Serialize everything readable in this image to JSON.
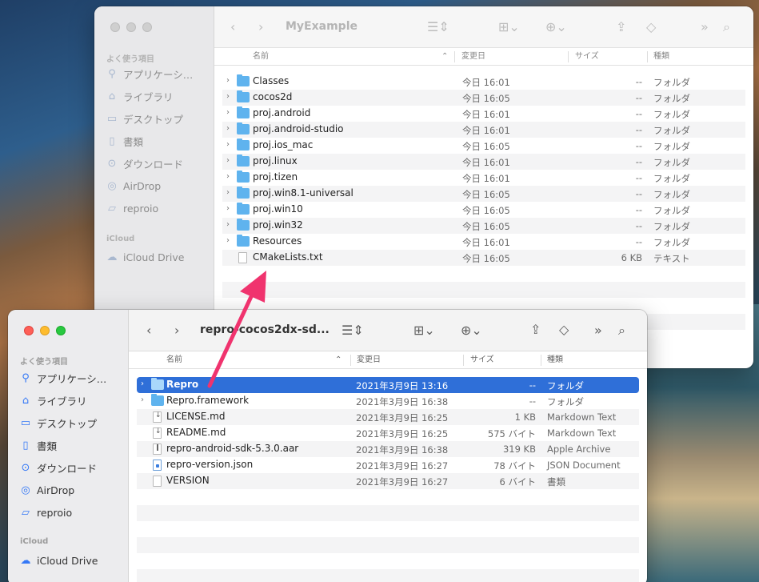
{
  "window_back": {
    "title": "MyExample",
    "sidebar": {
      "favorites_label": "よく使う項目",
      "items": [
        {
          "label": "アプリケーシ…",
          "icon": "applications-icon"
        },
        {
          "label": "ライブラリ",
          "icon": "library-icon"
        },
        {
          "label": "デスクトップ",
          "icon": "desktop-icon"
        },
        {
          "label": "書類",
          "icon": "documents-icon"
        },
        {
          "label": "ダウンロード",
          "icon": "downloads-icon"
        },
        {
          "label": "AirDrop",
          "icon": "airdrop-icon"
        },
        {
          "label": "reproio",
          "icon": "folder-icon"
        }
      ],
      "icloud_label": "iCloud",
      "icloud_items": [
        {
          "label": "iCloud Drive",
          "icon": "cloud-icon"
        }
      ]
    },
    "columns": {
      "name": "名前",
      "modified": "変更日",
      "size": "サイズ",
      "kind": "種類"
    },
    "rows": [
      {
        "name": "Classes",
        "date": "今日 16:01",
        "size": "--",
        "kind": "フォルダ",
        "type": "folder"
      },
      {
        "name": "cocos2d",
        "date": "今日 16:05",
        "size": "--",
        "kind": "フォルダ",
        "type": "folder"
      },
      {
        "name": "proj.android",
        "date": "今日 16:01",
        "size": "--",
        "kind": "フォルダ",
        "type": "folder"
      },
      {
        "name": "proj.android-studio",
        "date": "今日 16:01",
        "size": "--",
        "kind": "フォルダ",
        "type": "folder"
      },
      {
        "name": "proj.ios_mac",
        "date": "今日 16:05",
        "size": "--",
        "kind": "フォルダ",
        "type": "folder"
      },
      {
        "name": "proj.linux",
        "date": "今日 16:01",
        "size": "--",
        "kind": "フォルダ",
        "type": "folder"
      },
      {
        "name": "proj.tizen",
        "date": "今日 16:01",
        "size": "--",
        "kind": "フォルダ",
        "type": "folder"
      },
      {
        "name": "proj.win8.1-universal",
        "date": "今日 16:05",
        "size": "--",
        "kind": "フォルダ",
        "type": "folder"
      },
      {
        "name": "proj.win10",
        "date": "今日 16:05",
        "size": "--",
        "kind": "フォルダ",
        "type": "folder"
      },
      {
        "name": "proj.win32",
        "date": "今日 16:05",
        "size": "--",
        "kind": "フォルダ",
        "type": "folder"
      },
      {
        "name": "Resources",
        "date": "今日 16:01",
        "size": "--",
        "kind": "フォルダ",
        "type": "folder"
      },
      {
        "name": "CMakeLists.txt",
        "date": "今日 16:05",
        "size": "6 KB",
        "kind": "テキスト",
        "type": "doc"
      }
    ]
  },
  "window_front": {
    "title": "repro-cocos2dx-sd...",
    "sidebar": {
      "favorites_label": "よく使う項目",
      "items": [
        {
          "label": "アプリケーシ…",
          "icon": "applications-icon"
        },
        {
          "label": "ライブラリ",
          "icon": "library-icon"
        },
        {
          "label": "デスクトップ",
          "icon": "desktop-icon"
        },
        {
          "label": "書類",
          "icon": "documents-icon"
        },
        {
          "label": "ダウンロード",
          "icon": "downloads-icon"
        },
        {
          "label": "AirDrop",
          "icon": "airdrop-icon"
        },
        {
          "label": "reproio",
          "icon": "folder-icon"
        }
      ],
      "icloud_label": "iCloud",
      "icloud_items": [
        {
          "label": "iCloud Drive",
          "icon": "cloud-icon"
        }
      ]
    },
    "columns": {
      "name": "名前",
      "modified": "変更日",
      "size": "サイズ",
      "kind": "種類"
    },
    "rows": [
      {
        "name": "Repro",
        "date": "2021年3月9日 13:16",
        "size": "--",
        "kind": "フォルダ",
        "type": "folder",
        "selected": true
      },
      {
        "name": "Repro.framework",
        "date": "2021年3月9日 16:38",
        "size": "--",
        "kind": "フォルダ",
        "type": "folder"
      },
      {
        "name": "LICENSE.md",
        "date": "2021年3月9日 16:25",
        "size": "1 KB",
        "kind": "Markdown Text",
        "type": "md"
      },
      {
        "name": "README.md",
        "date": "2021年3月9日 16:25",
        "size": "575 バイト",
        "kind": "Markdown Text",
        "type": "md"
      },
      {
        "name": "repro-android-sdk-5.3.0.aar",
        "date": "2021年3月9日 16:38",
        "size": "319 KB",
        "kind": "Apple Archive",
        "type": "zip"
      },
      {
        "name": "repro-version.json",
        "date": "2021年3月9日 16:27",
        "size": "78 バイト",
        "kind": "JSON Document",
        "type": "json"
      },
      {
        "name": "VERSION",
        "date": "2021年3月9日 16:27",
        "size": "6 バイト",
        "kind": "書類",
        "type": "doc"
      }
    ]
  },
  "colors": {
    "selection": "#2f6fd8",
    "folder": "#5fb3ee",
    "arrow": "#f0336e",
    "accent": "#3478f6"
  }
}
